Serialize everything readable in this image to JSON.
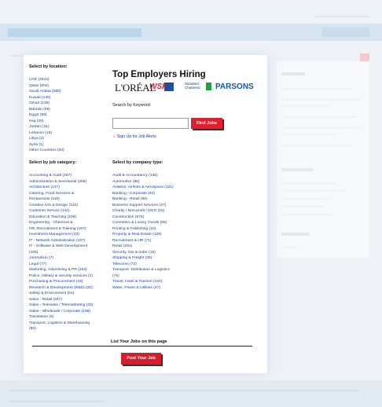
{
  "location": {
    "heading": "Select by location:",
    "items": [
      "UAE (2542)",
      "Qatar (604)",
      "Saudi Arabia (580)",
      "Kuwait (140)",
      "Oman (139)",
      "Bahrain (95)",
      "Egypt (89)",
      "Iraq (20)",
      "Jordan (15)",
      "Lebanon (15)",
      "Libya (2)",
      "Syria (1)",
      "Other Countries (53)"
    ]
  },
  "employers": {
    "heading": "Top Employers Hiring",
    "logos": [
      "L'ORÉAL",
      "WSP",
      "Standard Chartered",
      "PARSONS"
    ]
  },
  "search": {
    "keyword_label": "Search by Keyword:",
    "input_value": "",
    "find_button": "Find Jobs",
    "alert_link": "Sign Up for Job Alerts"
  },
  "category": {
    "heading": "Select by job category:",
    "items": [
      "Accounting & Audit (257)",
      "Administration & Secretarial (265)",
      "Architecture (147)",
      "Catering, Food Services &",
      "Restaurants (116)",
      "Creative Arts & Design (122)",
      "Customer Service (142)",
      "Education & Teaching (109)",
      "Engineering - Chemical &",
      "HR, Recruitment & Training (187)",
      "Investment Management (23)",
      "IT - Network Administration (107)",
      "IT - Software & Web Development",
      "(105)",
      "Journalism (7)",
      "Legal (77)",
      "Marketing, Advertising & PR (264)",
      "Police, military & security services (2)",
      "Purchasing & Procurement (43)",
      "Research & Development (R&D) (20)",
      "Safety & Environment (51)",
      "Sales - Retail (207)",
      "Sales - Telesales / Telemarketing (33)",
      "Sales - Wholesale / Corporate (199)",
      "Translation (6)",
      "Transport, Logistics & Warehousing",
      "(80)"
    ]
  },
  "company": {
    "heading": "Select by company type:",
    "items": [
      "Audit & Accountancy (135)",
      "Automotive (86)",
      "Aviation, Airlines & Aerospace (121)",
      "Banking - Corporate (92)",
      "Banking - Retail (66)",
      "Business Support Services (37)",
      "Charity / Non-profit / NGO (15)",
      "Construction (575)",
      "Cosmetics & Luxury Goods (55)",
      "Printing & Publishing (10)",
      "Property & Real Estate (128)",
      "Recruitment & HR (71)",
      "Retail (251)",
      "Security, law & order (15)",
      "Shipping & Freight (36)",
      "Telecoms (72)",
      "Transport, Distribution & Logistics",
      "(76)",
      "Travel, Hotel & Tourism (164)",
      "Water, Power & Utilities (47)"
    ]
  },
  "post": {
    "list_label": "List Your Jobs on this page",
    "button": "Post Your Job"
  },
  "colors": {
    "accent": "#e01f2f",
    "link": "#1b3f8f"
  }
}
